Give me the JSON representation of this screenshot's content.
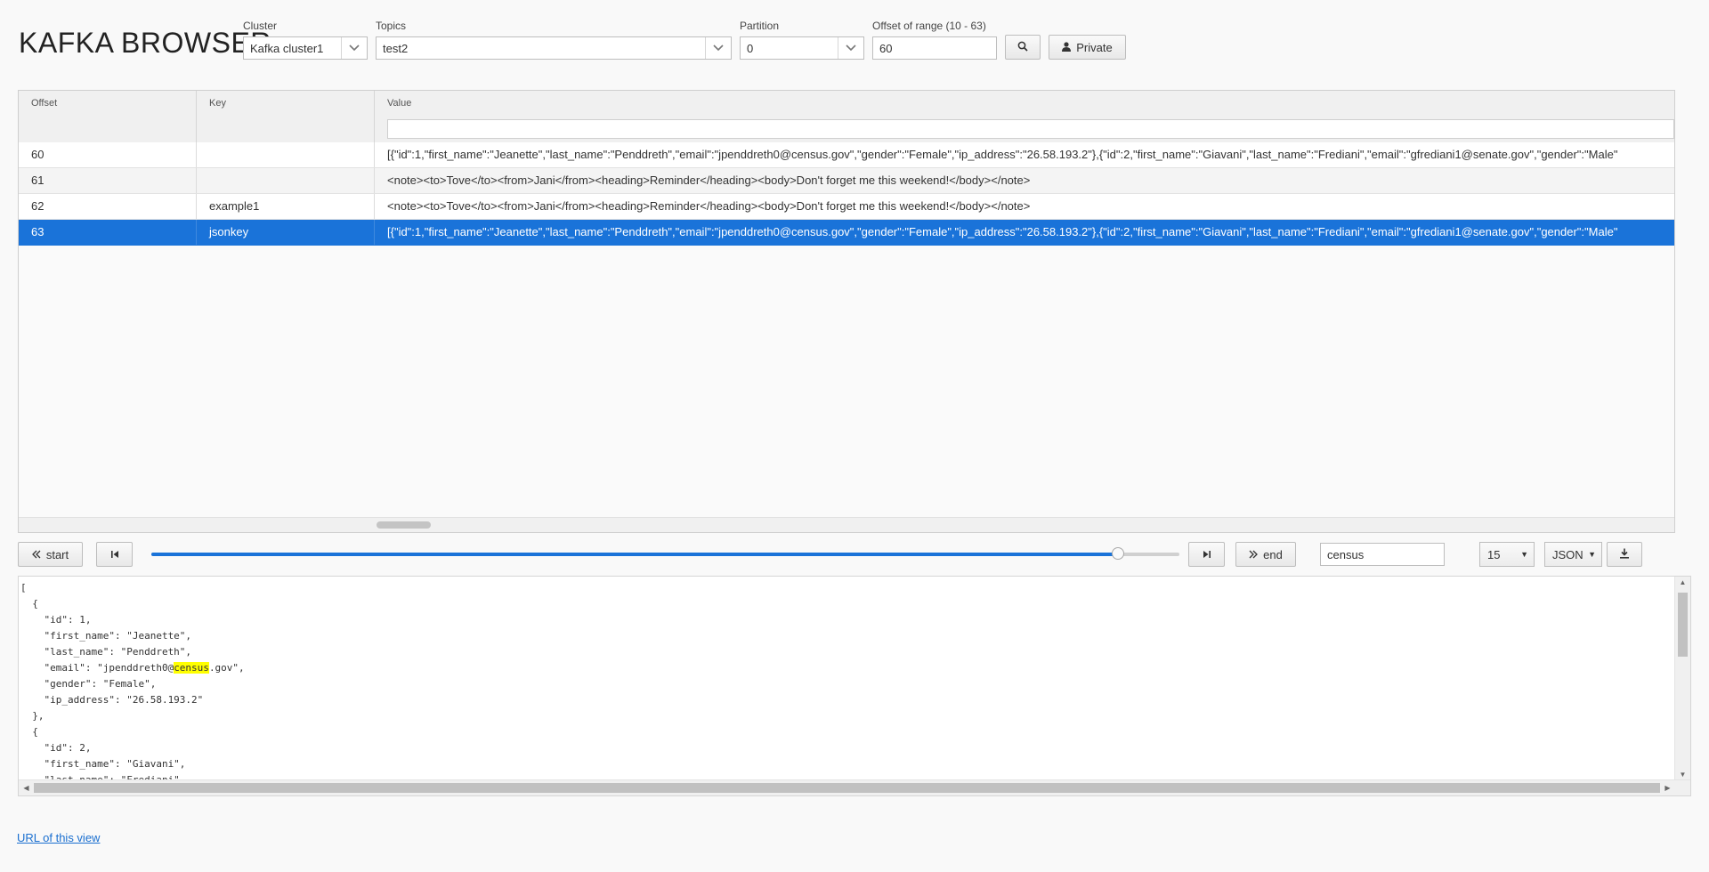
{
  "app": {
    "title": "KAFKA BROWSER"
  },
  "toolbar": {
    "cluster_label": "Cluster",
    "cluster_value": "Kafka cluster1",
    "topics_label": "Topics",
    "topics_value": "test2",
    "partition_label": "Partition",
    "partition_value": "0",
    "offset_label": "Offset of range (10 - 63)",
    "offset_value": "60",
    "search_icon": "search-icon",
    "private_label": "Private",
    "private_icon": "user-icon"
  },
  "grid": {
    "columns": [
      "Offset",
      "Key",
      "Value"
    ],
    "rows": [
      {
        "offset": "60",
        "key": "",
        "value": "[{\"id\":1,\"first_name\":\"Jeanette\",\"last_name\":\"Penddreth\",\"email\":\"jpenddreth0@census.gov\",\"gender\":\"Female\",\"ip_address\":\"26.58.193.2\"},{\"id\":2,\"first_name\":\"Giavani\",\"last_name\":\"Frediani\",\"email\":\"gfrediani1@senate.gov\",\"gender\":\"Male\""
      },
      {
        "offset": "61",
        "key": "",
        "value": "<note><to>Tove</to><from>Jani</from><heading>Reminder</heading><body>Don't forget me this weekend!</body></note>"
      },
      {
        "offset": "62",
        "key": "example1",
        "value": "<note><to>Tove</to><from>Jani</from><heading>Reminder</heading><body>Don't forget me this weekend!</body></note>"
      },
      {
        "offset": "63",
        "key": "jsonkey",
        "value": "[{\"id\":1,\"first_name\":\"Jeanette\",\"last_name\":\"Penddreth\",\"email\":\"jpenddreth0@census.gov\",\"gender\":\"Female\",\"ip_address\":\"26.58.193.2\"},{\"id\":2,\"first_name\":\"Giavani\",\"last_name\":\"Frediani\",\"email\":\"gfrediani1@senate.gov\",\"gender\":\"Male\""
      }
    ],
    "selected_row": 3
  },
  "pager": {
    "start_label": "start",
    "end_label": "end",
    "slider_position": 0.94,
    "search_value": "census",
    "page_size": "15",
    "format": "JSON",
    "download_icon": "download-icon",
    "prev_icon": "skip-previous-icon",
    "next_icon": "skip-next-icon"
  },
  "viewer": {
    "lines": [
      "[",
      "  {",
      "    \"id\": 1,",
      "    \"first_name\": \"Jeanette\",",
      "    \"last_name\": \"Penddreth\",",
      "    \"email\": \"jpenddreth0@census.gov\",",
      "    \"gender\": \"Female\",",
      "    \"ip_address\": \"26.58.193.2\"",
      "  },",
      "  {",
      "    \"id\": 2,",
      "    \"first_name\": \"Giavani\",",
      "    \"last_name\": \"Frediani\","
    ],
    "highlight": "census"
  },
  "footer": {
    "link_label": "URL of this view"
  },
  "colors": {
    "accent": "#1a73d9",
    "highlight": "#ffff00",
    "link": "#1a6fd0"
  }
}
